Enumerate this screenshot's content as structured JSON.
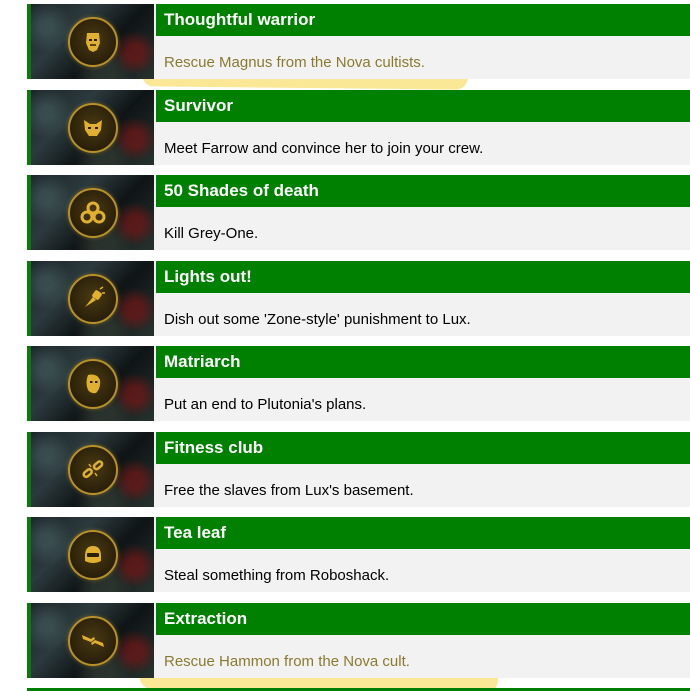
{
  "achievements": [
    {
      "title": "Thoughtful warrior",
      "description": "Rescue Magnus from the Nova cultists.",
      "icon": "mask-icon"
    },
    {
      "title": "Survivor",
      "description": "Meet Farrow and convince her to join your crew.",
      "icon": "cat-head-icon"
    },
    {
      "title": "50 Shades of death",
      "description": "Kill Grey-One.",
      "icon": "triple-circles-icon"
    },
    {
      "title": "Lights out!",
      "description": "Dish out some 'Zone-style' punishment to Lux.",
      "icon": "punch-icon"
    },
    {
      "title": "Matriarch",
      "description": "Put an end to Plutonia's plans.",
      "icon": "face-icon"
    },
    {
      "title": "Fitness club",
      "description": "Free the slaves from Lux's basement.",
      "icon": "broken-chain-icon"
    },
    {
      "title": "Tea leaf",
      "description": "Steal something from Roboshack.",
      "icon": "helmet-icon"
    },
    {
      "title": "Extraction",
      "description": "Rescue Hammon from the Nova cult.",
      "icon": "hands-icon"
    }
  ],
  "colors": {
    "header_green": "#008000",
    "badge_gold": "#b8902a",
    "highlighter_yellow": "#f6d640"
  }
}
